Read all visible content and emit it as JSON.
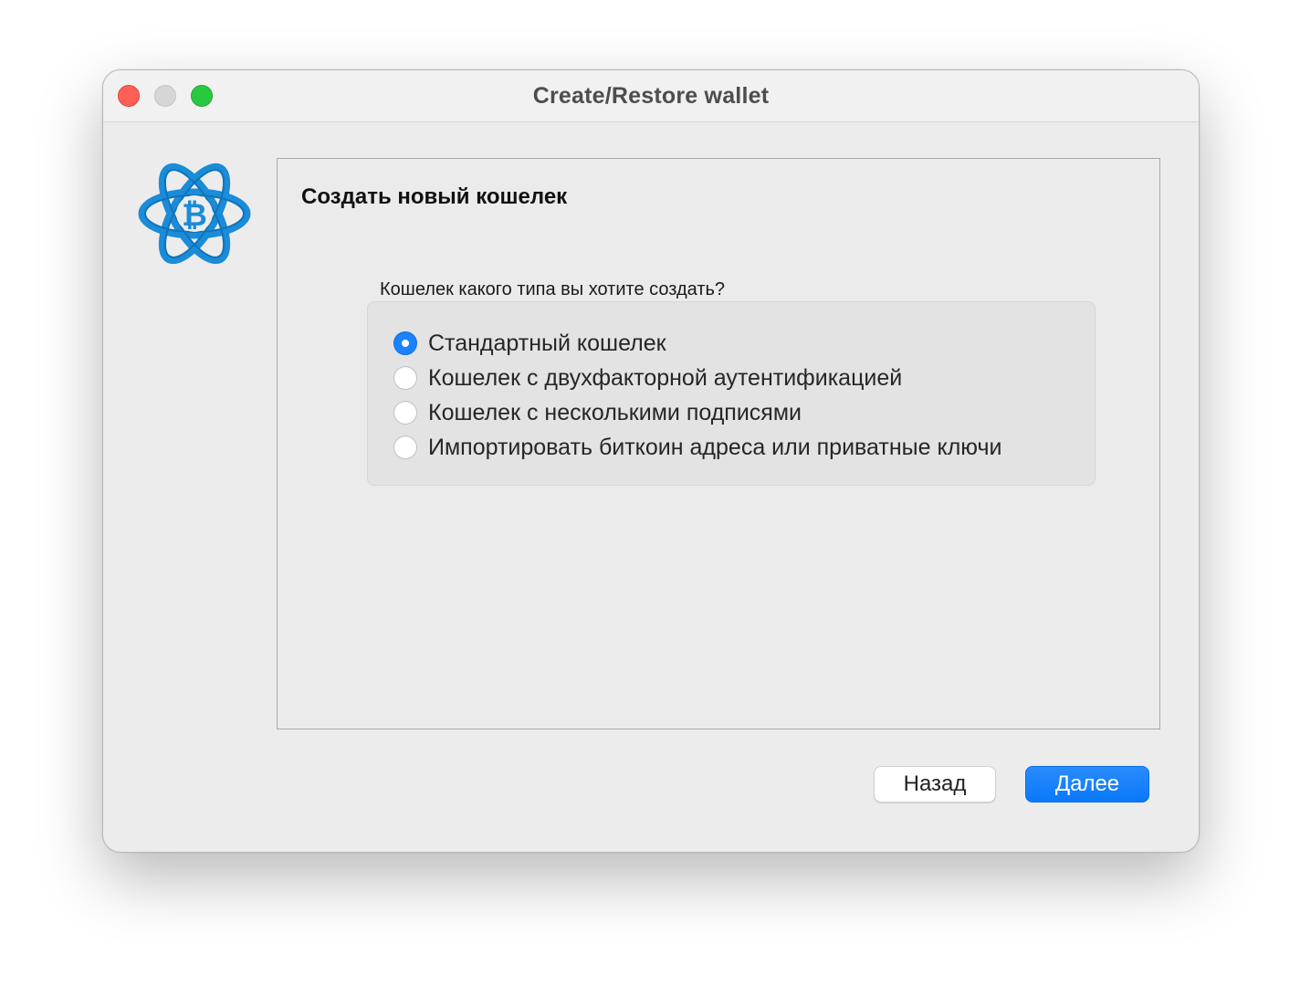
{
  "window": {
    "title": "Create/Restore wallet"
  },
  "logo": {
    "icon": "electrum-bitcoin-atom-icon",
    "color": "#1a8cd8"
  },
  "panel": {
    "heading": "Создать новый кошелек",
    "question": "Кошелек какого типа вы хотите создать?",
    "options": [
      {
        "label": "Стандартный кошелек",
        "selected": true
      },
      {
        "label": "Кошелек с двухфакторной аутентификацией",
        "selected": false
      },
      {
        "label": "Кошелек с несколькими подписями",
        "selected": false
      },
      {
        "label": "Импортировать биткоин адреса или приватные ключи",
        "selected": false
      }
    ]
  },
  "buttons": {
    "back_label": "Назад",
    "next_label": "Далее"
  },
  "colors": {
    "accent": "#1a82fb",
    "close": "#fe5f57",
    "minimize": "#d6d6d6",
    "zoom": "#28c840"
  }
}
